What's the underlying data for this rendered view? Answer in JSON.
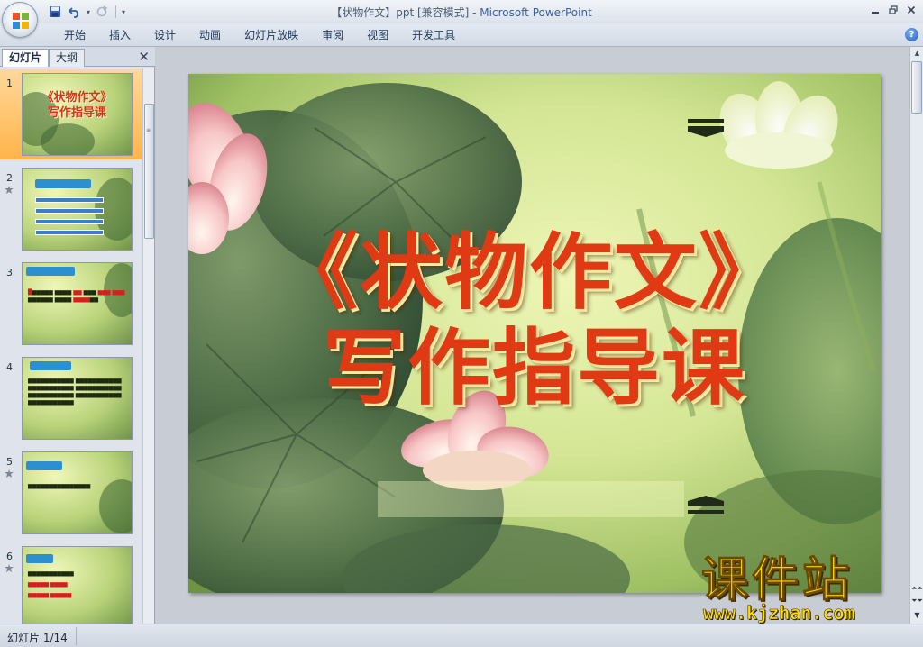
{
  "window": {
    "title_doc": "【状物作文】ppt [兼容模式] - ",
    "title_app": "Microsoft PowerPoint"
  },
  "qat": {
    "icons": [
      "save-icon",
      "undo-icon",
      "redo-icon",
      "customize-qat-icon"
    ]
  },
  "ribbon": {
    "tabs": [
      "开始",
      "插入",
      "设计",
      "动画",
      "幻灯片放映",
      "审阅",
      "视图",
      "开发工具"
    ]
  },
  "left_pane": {
    "tab_slides": "幻灯片",
    "tab_outline": "大纲",
    "thumbnails": [
      {
        "num": "1",
        "title_line1": "《状物作文》",
        "title_line2": "写作指导课"
      },
      {
        "num": "2"
      },
      {
        "num": "3"
      },
      {
        "num": "4"
      },
      {
        "num": "5"
      },
      {
        "num": "6"
      }
    ]
  },
  "slide": {
    "title_line1": "《状物作文》",
    "title_line2": "写作指导课"
  },
  "status": {
    "slide_indicator": "幻灯片 1/14"
  },
  "watermark": {
    "name": "课件站",
    "url": "www.kjzhan.com"
  },
  "colors": {
    "title_red": "#e03a14",
    "selected_thumb": "#ffb44a",
    "watermark_yellow": "#f6d400"
  }
}
